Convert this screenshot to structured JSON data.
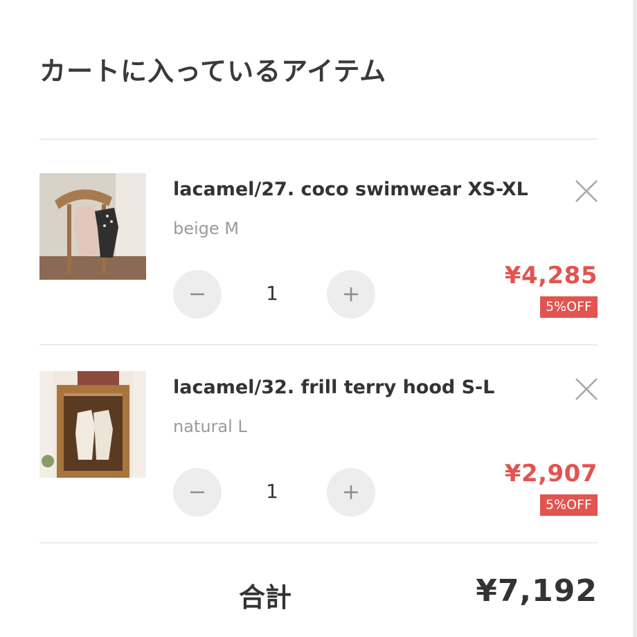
{
  "cart": {
    "title": "カートに入っているアイテム",
    "items": [
      {
        "name": "lacamel/27. coco swimwear XS-XL",
        "variant": "beige M",
        "quantity": "1",
        "price": "¥4,285",
        "discount": "5%OFF",
        "thumbnail_icon": "product-photo-swimwear"
      },
      {
        "name": "lacamel/32. frill terry hood S-L",
        "variant": "natural L",
        "quantity": "1",
        "price": "¥2,907",
        "discount": "5%OFF",
        "thumbnail_icon": "product-photo-terry-hood"
      }
    ],
    "total_label": "合計",
    "total_value": "¥7,192"
  },
  "colors": {
    "accent": "#e25450",
    "button_bg": "#ededed",
    "text": "#333333",
    "muted": "#9a9a9a",
    "divider": "#ececec"
  },
  "icons": {
    "remove": "close-icon",
    "decrement": "minus-icon",
    "increment": "plus-icon"
  }
}
